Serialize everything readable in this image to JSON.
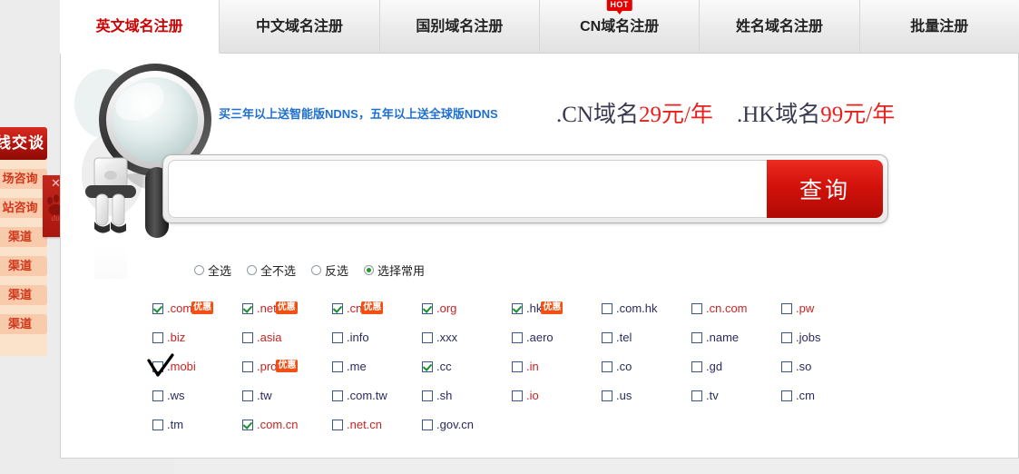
{
  "tabs": [
    {
      "label": "英文域名注册",
      "active": true,
      "hot": false
    },
    {
      "label": "中文域名注册",
      "active": false,
      "hot": false
    },
    {
      "label": "国别域名注册",
      "active": false,
      "hot": false
    },
    {
      "label": "CN域名注册",
      "active": false,
      "hot": true,
      "hot_label": "HOT"
    },
    {
      "label": "姓名域名注册",
      "active": false,
      "hot": false
    },
    {
      "label": "批量注册",
      "active": false,
      "hot": false
    }
  ],
  "promo": {
    "blue_text": "买三年以上送智能版NDNS，五年以上送全球版NDNS",
    "price_cn_prefix": ".CN域名",
    "price_cn_amount": "29",
    "price_cn_unit": "元/年",
    "price_hk_prefix": ".HK域名",
    "price_hk_amount": "99",
    "price_hk_unit": "元/年"
  },
  "search": {
    "value": "",
    "placeholder": "",
    "button_label": "查询"
  },
  "select_modes": [
    {
      "label": "全选",
      "selected": false
    },
    {
      "label": "全不选",
      "selected": false
    },
    {
      "label": "反选",
      "selected": false
    },
    {
      "label": "选择常用",
      "selected": true
    }
  ],
  "suffix_rows": [
    [
      {
        "name": ".com",
        "checked": true,
        "color": "red",
        "badge": "优惠"
      },
      {
        "name": ".net",
        "checked": true,
        "color": "red",
        "badge": "优惠"
      },
      {
        "name": ".cn",
        "checked": true,
        "color": "red",
        "badge": "优惠"
      },
      {
        "name": ".org",
        "checked": true,
        "color": "red",
        "badge": ""
      },
      {
        "name": ".hk",
        "checked": true,
        "color": "navy",
        "badge": "优惠"
      },
      {
        "name": ".com.hk",
        "checked": false,
        "color": "navy",
        "badge": ""
      },
      {
        "name": ".cn.com",
        "checked": false,
        "color": "red",
        "badge": ""
      },
      {
        "name": ".pw",
        "checked": false,
        "color": "red",
        "badge": ""
      }
    ],
    [
      {
        "name": ".biz",
        "checked": false,
        "color": "red",
        "badge": ""
      },
      {
        "name": ".asia",
        "checked": false,
        "color": "red",
        "badge": ""
      },
      {
        "name": ".info",
        "checked": false,
        "color": "navy",
        "badge": ""
      },
      {
        "name": ".xxx",
        "checked": false,
        "color": "navy",
        "badge": ""
      },
      {
        "name": ".aero",
        "checked": false,
        "color": "navy",
        "badge": ""
      },
      {
        "name": ".tel",
        "checked": false,
        "color": "navy",
        "badge": ""
      },
      {
        "name": ".name",
        "checked": false,
        "color": "navy",
        "badge": ""
      },
      {
        "name": ".jobs",
        "checked": false,
        "color": "navy",
        "badge": ""
      }
    ],
    [
      {
        "name": ".mobi",
        "checked": false,
        "color": "red",
        "badge": ""
      },
      {
        "name": ".pro",
        "checked": false,
        "color": "red",
        "badge": "优惠"
      },
      {
        "name": ".me",
        "checked": false,
        "color": "navy",
        "badge": ""
      },
      {
        "name": ".cc",
        "checked": true,
        "color": "navy",
        "badge": ""
      },
      {
        "name": ".in",
        "checked": false,
        "color": "red",
        "badge": ""
      },
      {
        "name": ".co",
        "checked": false,
        "color": "navy",
        "badge": ""
      },
      {
        "name": ".gd",
        "checked": false,
        "color": "navy",
        "badge": ""
      },
      {
        "name": ".so",
        "checked": false,
        "color": "navy",
        "badge": ""
      }
    ],
    [
      {
        "name": ".ws",
        "checked": false,
        "color": "navy",
        "badge": ""
      },
      {
        "name": ".tw",
        "checked": false,
        "color": "navy",
        "badge": ""
      },
      {
        "name": ".com.tw",
        "checked": false,
        "color": "navy",
        "badge": ""
      },
      {
        "name": ".sh",
        "checked": false,
        "color": "navy",
        "badge": ""
      },
      {
        "name": ".io",
        "checked": false,
        "color": "red",
        "badge": ""
      },
      {
        "name": ".us",
        "checked": false,
        "color": "navy",
        "badge": ""
      },
      {
        "name": ".tv",
        "checked": false,
        "color": "navy",
        "badge": ""
      },
      {
        "name": ".cm",
        "checked": false,
        "color": "navy",
        "badge": ""
      }
    ],
    [
      {
        "name": ".tm",
        "checked": false,
        "color": "navy",
        "badge": ""
      },
      {
        "name": ".com.cn",
        "checked": true,
        "color": "red",
        "badge": ""
      },
      {
        "name": ".net.cn",
        "checked": false,
        "color": "red",
        "badge": ""
      },
      {
        "name": ".gov.cn",
        "checked": false,
        "color": "navy",
        "badge": ""
      }
    ]
  ],
  "left_rail": {
    "chat_header": "线交谈",
    "items": [
      {
        "label": "场咨询"
      },
      {
        "label": "站咨询"
      },
      {
        "label": "渠道"
      },
      {
        "label": "渠道"
      },
      {
        "label": "渠道"
      },
      {
        "label": "渠道"
      }
    ],
    "close_label": "✕"
  },
  "colors": {
    "accent_red": "#cc0000",
    "button_red": "#d2120b",
    "badge_orange": "#f24f12",
    "link_blue": "#1f6fd0",
    "suffix_navy": "#2b2b5e",
    "suffix_red": "#cc2222"
  }
}
